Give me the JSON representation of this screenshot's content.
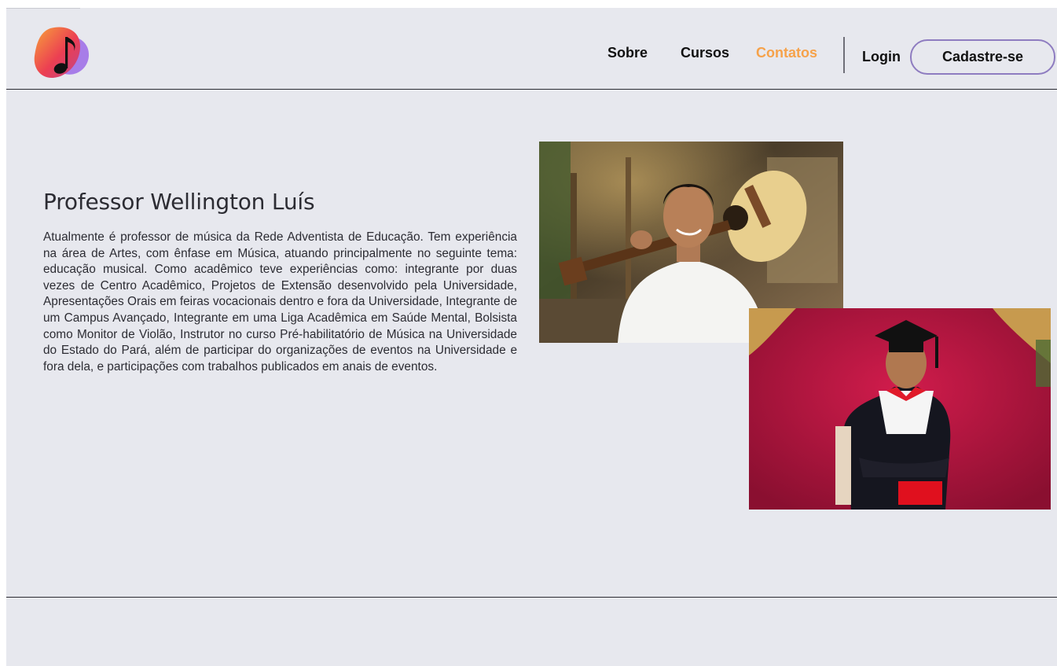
{
  "header": {
    "logo": {
      "icon": "music-note-icon",
      "colors": [
        "#f7a23a",
        "#ec3f52",
        "#a77de8"
      ]
    },
    "nav": [
      {
        "label": "Sobre",
        "active": false
      },
      {
        "label": "Cursos",
        "active": false
      },
      {
        "label": "Contatos",
        "active": true
      }
    ],
    "login_label": "Login",
    "signup_label": "Cadastre-se",
    "colors": {
      "active_link": "#f6a24a",
      "signup_border": "#8e7cc0"
    }
  },
  "professor": {
    "name": "Professor Wellington Luís",
    "bio": "Atualmente é professor de música da Rede Adventista de Educação. Tem experiência na área de Artes, com ênfase em Música, atuando principalmente no seguinte tema: educação musical. Como acadêmico teve experiências como: integrante por duas vezes de Centro Acadêmico, Projetos de Extensão desenvolvido pela Universidade, Apresentações Orais em feiras vocacionais dentro e fora da Universidade, Integrante de um Campus Avançado, Integrante em uma Liga Acadêmica em Saúde Mental, Bolsista como Monitor de Violão, Instrutor no curso Pré-habilitatório de Música na Universidade do Estado do Pará, além de participar do organizações de eventos na Universidade e fora dela, e participações com trabalhos publicados em anais de eventos."
  },
  "colors": {
    "page_background": "#e7e8ee",
    "text": "#2c2c33"
  }
}
